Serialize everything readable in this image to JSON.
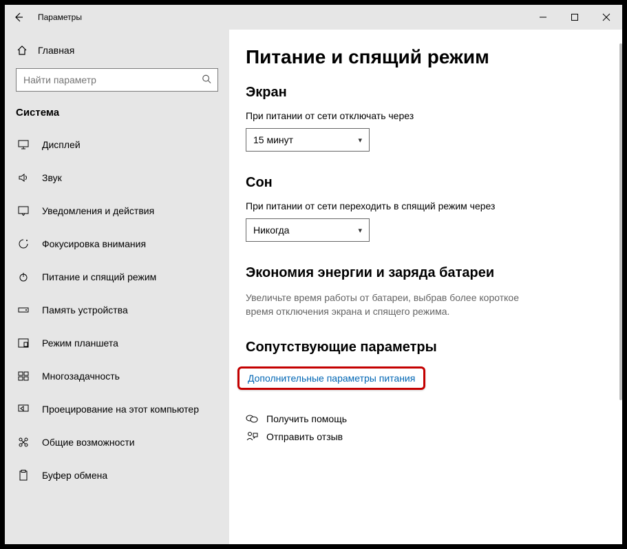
{
  "window": {
    "title": "Параметры"
  },
  "sidebar": {
    "home": "Главная",
    "search_placeholder": "Найти параметр",
    "category": "Система",
    "items": [
      {
        "label": "Дисплей"
      },
      {
        "label": "Звук"
      },
      {
        "label": "Уведомления и действия"
      },
      {
        "label": "Фокусировка внимания"
      },
      {
        "label": "Питание и спящий режим"
      },
      {
        "label": "Память устройства"
      },
      {
        "label": "Режим планшета"
      },
      {
        "label": "Многозадачность"
      },
      {
        "label": "Проецирование на этот компьютер"
      },
      {
        "label": "Общие возможности"
      },
      {
        "label": "Буфер обмена"
      }
    ]
  },
  "main": {
    "heading": "Питание и спящий режим",
    "screen": {
      "title": "Экран",
      "label": "При питании от сети отключать через",
      "value": "15 минут"
    },
    "sleep": {
      "title": "Сон",
      "label": "При питании от сети переходить в спящий режим через",
      "value": "Никогда"
    },
    "battery": {
      "title": "Экономия энергии и заряда батареи",
      "hint": "Увеличьте время работы от батареи, выбрав более короткое время отключения экрана и спящего режима."
    },
    "related": {
      "title": "Сопутствующие параметры",
      "link": "Дополнительные параметры питания"
    },
    "help": "Получить помощь",
    "feedback": "Отправить отзыв"
  }
}
